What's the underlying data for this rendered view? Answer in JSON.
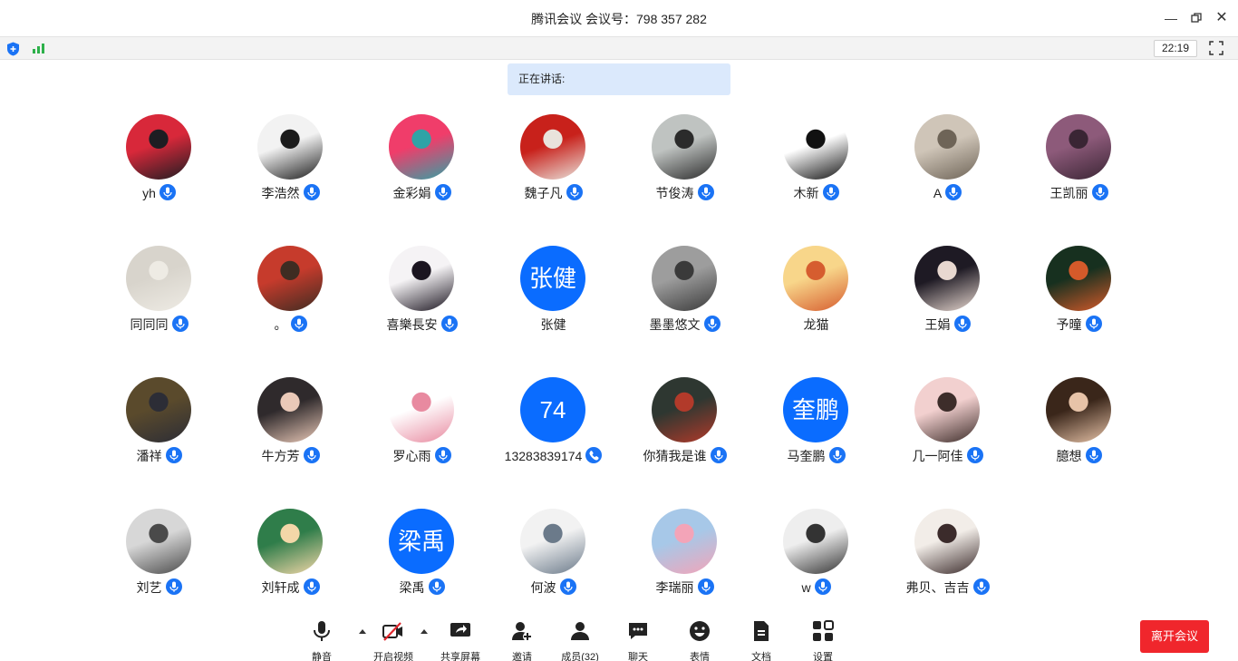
{
  "window": {
    "title": "腾讯会议 会议号：798 357 282"
  },
  "status": {
    "time": "22:19"
  },
  "speaking": {
    "label": "正在讲话:"
  },
  "participants": [
    {
      "name": "yh",
      "status": "mic",
      "avatar": {
        "kind": "image",
        "colors": [
          "#d8283a",
          "#1d1d22"
        ]
      }
    },
    {
      "name": "李浩然",
      "status": "mic",
      "avatar": {
        "kind": "image",
        "colors": [
          "#f2f2f2",
          "#1c1c1c"
        ]
      }
    },
    {
      "name": "金彩娟",
      "status": "mic",
      "avatar": {
        "kind": "image",
        "colors": [
          "#f03d6a",
          "#2fa3a6"
        ]
      }
    },
    {
      "name": "魏子凡",
      "status": "mic",
      "avatar": {
        "kind": "image",
        "colors": [
          "#c8211b",
          "#e9e3dc"
        ]
      }
    },
    {
      "name": "节俊涛",
      "status": "mic",
      "avatar": {
        "kind": "image",
        "colors": [
          "#bfc3c1",
          "#2b2b2b"
        ]
      }
    },
    {
      "name": "木新",
      "status": "mic",
      "avatar": {
        "kind": "image",
        "colors": [
          "#ffffff",
          "#111111"
        ]
      }
    },
    {
      "name": "A",
      "status": "mic",
      "avatar": {
        "kind": "image",
        "colors": [
          "#cfc5b8",
          "#6e6457"
        ]
      }
    },
    {
      "name": "王凯丽",
      "status": "mic",
      "avatar": {
        "kind": "image",
        "colors": [
          "#8d5a7a",
          "#3a2534"
        ]
      }
    },
    {
      "name": "同同同",
      "status": "mic",
      "avatar": {
        "kind": "image",
        "colors": [
          "#d8d4cc",
          "#eeebe4"
        ]
      }
    },
    {
      "name": "。",
      "status": "mic",
      "avatar": {
        "kind": "image",
        "colors": [
          "#c63b2c",
          "#3e2c22"
        ]
      }
    },
    {
      "name": "喜樂長安",
      "status": "mic",
      "avatar": {
        "kind": "image",
        "colors": [
          "#f5f3f5",
          "#1b1520"
        ]
      }
    },
    {
      "name": "张健",
      "status": "none",
      "avatar": {
        "kind": "text",
        "text": "张健"
      }
    },
    {
      "name": "墨墨悠文",
      "status": "mic",
      "avatar": {
        "kind": "image",
        "colors": [
          "#9d9d9d",
          "#3a3a3a"
        ]
      }
    },
    {
      "name": "龙猫",
      "status": "none",
      "avatar": {
        "kind": "image",
        "colors": [
          "#f8d68a",
          "#d65d2f"
        ]
      }
    },
    {
      "name": "王娟",
      "status": "mic",
      "avatar": {
        "kind": "image",
        "colors": [
          "#1e1a24",
          "#e8d8d0"
        ]
      }
    },
    {
      "name": "予曈",
      "status": "mic",
      "avatar": {
        "kind": "image",
        "colors": [
          "#17301f",
          "#d55a2a"
        ]
      }
    },
    {
      "name": "潘祥",
      "status": "mic",
      "avatar": {
        "kind": "image",
        "colors": [
          "#5a4a2c",
          "#2c2d36"
        ]
      }
    },
    {
      "name": "牛方芳",
      "status": "mic",
      "avatar": {
        "kind": "image",
        "colors": [
          "#2f2a2c",
          "#eac9b8"
        ]
      }
    },
    {
      "name": "罗心雨",
      "status": "mic",
      "avatar": {
        "kind": "image",
        "colors": [
          "#ffffff",
          "#e88aa0"
        ]
      }
    },
    {
      "name": "13283839174",
      "status": "phone",
      "avatar": {
        "kind": "text",
        "text": "74"
      }
    },
    {
      "name": "你猜我是谁",
      "status": "mic",
      "avatar": {
        "kind": "image",
        "colors": [
          "#2e3731",
          "#b23a2a"
        ]
      }
    },
    {
      "name": "马奎鹏",
      "status": "mic",
      "avatar": {
        "kind": "text",
        "text": "奎鹏"
      }
    },
    {
      "name": "几一阿佳",
      "status": "mic",
      "avatar": {
        "kind": "image",
        "colors": [
          "#f2d0cf",
          "#3d2d2a"
        ]
      }
    },
    {
      "name": "臆想",
      "status": "mic",
      "avatar": {
        "kind": "image",
        "colors": [
          "#3a261a",
          "#e7c3a8"
        ]
      }
    },
    {
      "name": "刘艺",
      "status": "mic",
      "avatar": {
        "kind": "image",
        "colors": [
          "#d7d7d7",
          "#4a4a4a"
        ]
      }
    },
    {
      "name": "刘轩成",
      "status": "mic",
      "avatar": {
        "kind": "image",
        "colors": [
          "#2f7d4a",
          "#f3d7a8"
        ]
      }
    },
    {
      "name": "梁禹",
      "status": "mic",
      "avatar": {
        "kind": "text",
        "text": "梁禹"
      }
    },
    {
      "name": "何波",
      "status": "mic",
      "avatar": {
        "kind": "image",
        "colors": [
          "#f2f2f2",
          "#6b7a8a"
        ]
      }
    },
    {
      "name": "李瑞丽",
      "status": "mic",
      "avatar": {
        "kind": "image",
        "colors": [
          "#a7c8e8",
          "#f3a4b8"
        ]
      }
    },
    {
      "name": "w",
      "status": "mic",
      "avatar": {
        "kind": "image",
        "colors": [
          "#eeeeee",
          "#333333"
        ]
      }
    },
    {
      "name": "弗贝、吉吉",
      "status": "mic",
      "avatar": {
        "kind": "image",
        "colors": [
          "#f2ede8",
          "#3b2b2b"
        ]
      }
    }
  ],
  "toolbar": {
    "mute": "静音",
    "video": "开启视频",
    "share": "共享屏幕",
    "invite": "邀请",
    "members": "成员(32)",
    "chat": "聊天",
    "emoji": "表情",
    "docs": "文档",
    "settings": "设置",
    "leave": "离开会议"
  },
  "colors": {
    "accent": "#0a6cff",
    "leave": "#f0262c",
    "speaking_bg": "#dbe9fc"
  },
  "icons": [
    "shield-icon",
    "signal-icon",
    "fullscreen-icon",
    "minimize-icon",
    "restore-icon",
    "close-icon",
    "mic-icon",
    "phone-icon",
    "video-off-icon",
    "share-screen-icon",
    "invite-icon",
    "members-icon",
    "chat-icon",
    "emoji-icon",
    "docs-icon",
    "settings-icon"
  ]
}
